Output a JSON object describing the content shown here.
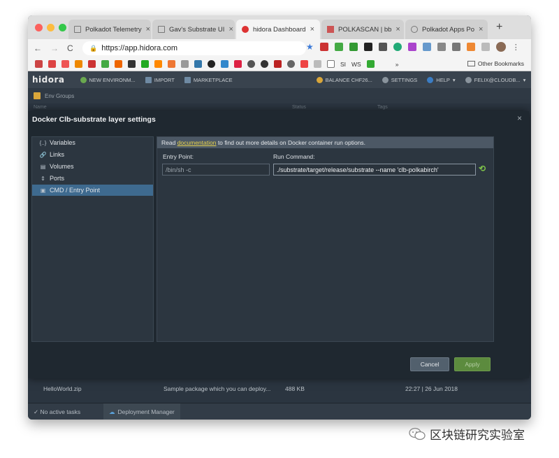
{
  "browser": {
    "tabs": [
      {
        "label": "Polkadot Telemetry",
        "close": "×"
      },
      {
        "label": "Gav's Substrate UI",
        "close": "×"
      },
      {
        "label": "hidora Dashboard",
        "close": "×"
      },
      {
        "label": "POLKASCAN | bb",
        "close": "×"
      },
      {
        "label": "Polkadot Apps Po",
        "close": "×"
      }
    ],
    "new_tab": "+",
    "url": "https://app.hidora.com",
    "nav": {
      "back": "←",
      "forward": "→",
      "reload": "C"
    },
    "bookmarks": {
      "items": [
        "SI",
        "WS"
      ],
      "overflow": "»",
      "other": "Other Bookmarks"
    }
  },
  "app": {
    "logo": "hidora",
    "header": {
      "new_env": "NEW ENVIRONM...",
      "import": "IMPORT",
      "marketplace": "MARKETPLACE",
      "balance": "BALANCE CHF26...",
      "settings": "SETTINGS",
      "help": "HELP",
      "user": "FELIX@CLOUDB..."
    },
    "env_groups": "Env Groups",
    "columns": {
      "name": "Name",
      "status": "Status",
      "tags": "Tags"
    },
    "file_row": {
      "name": "HelloWorld.zip",
      "description": "Sample package which you can deploy...",
      "size": "488 KB",
      "date": "22:27 | 26 Jun 2018"
    },
    "taskbar": {
      "tasks": "No active tasks",
      "deployment": "Deployment Manager"
    }
  },
  "modal": {
    "title": "Docker Clb-substrate layer settings",
    "close": "×",
    "sidebar": [
      {
        "icon": "{..}",
        "label": "Variables"
      },
      {
        "icon": "🔗",
        "label": "Links"
      },
      {
        "icon": "▤",
        "label": "Volumes"
      },
      {
        "icon": "⇕",
        "label": "Ports"
      },
      {
        "icon": "▣",
        "label": "CMD / Entry Point"
      }
    ],
    "info_prefix": "Read ",
    "info_link": "documentation",
    "info_suffix": " to find out more details on Docker container run options.",
    "entry_point_label": "Entry Point:",
    "entry_point_value": "/bin/sh -c",
    "run_command_label": "Run Command:",
    "run_command_value": "./substrate/target/release/substrate --name 'clb-polkabirch'",
    "cancel": "Cancel",
    "apply": "Apply"
  },
  "watermark": {
    "text": "区块链研究实验室"
  },
  "colors": {
    "accent": "#3e6a8f",
    "apply": "#5c8b3e",
    "link": "#e7d24d"
  }
}
